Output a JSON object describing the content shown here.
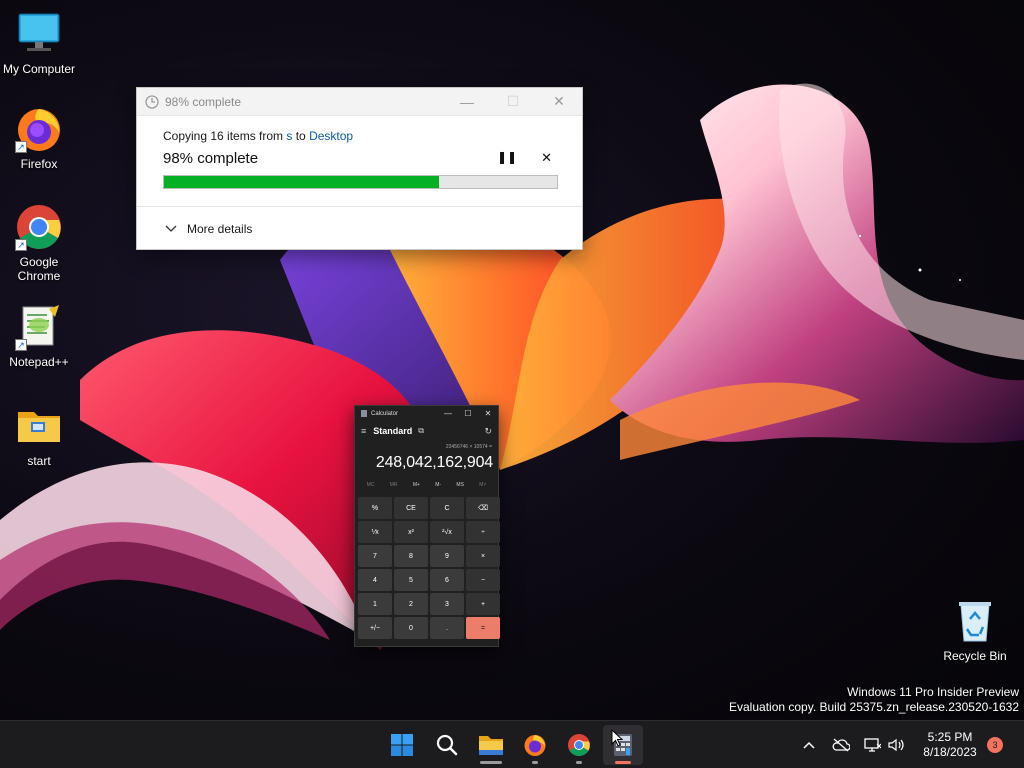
{
  "desktop": {
    "icons": [
      {
        "label": "My Computer",
        "icon": "monitor-icon"
      },
      {
        "label": "Firefox",
        "icon": "firefox-icon"
      },
      {
        "label": "Google Chrome",
        "icon": "chrome-icon"
      },
      {
        "label": "Notepad++",
        "icon": "notepadpp-icon"
      },
      {
        "label": "start",
        "icon": "folder-icon"
      },
      {
        "label": "Recycle Bin",
        "icon": "recycle-bin-icon"
      }
    ]
  },
  "copy_dialog": {
    "title": "98% complete",
    "copy_prefix": "Copying 16 items from ",
    "source": "s",
    "to_word": " to ",
    "destination": "Desktop",
    "status": "98% complete",
    "progress_percent": 70,
    "more_details": "More details",
    "accent_color": "#06b025"
  },
  "calculator": {
    "title": "Calculator",
    "mode": "Standard",
    "expression": "23456746 × 10574 =",
    "display": "248,042,162,904",
    "memory": [
      "MC",
      "MR",
      "M+",
      "M-",
      "MS",
      "M˅"
    ],
    "keys": [
      "%",
      "CE",
      "C",
      "⌫",
      "⅟x",
      "x²",
      "²√x",
      "÷",
      "7",
      "8",
      "9",
      "×",
      "4",
      "5",
      "6",
      "−",
      "1",
      "2",
      "3",
      "+",
      "+/−",
      "0",
      ".",
      "="
    ]
  },
  "watermark": {
    "line1": "Windows 11 Pro Insider Preview",
    "line2": "Evaluation copy. Build 25375.zn_release.230520-1632"
  },
  "taskbar": {
    "apps": [
      "start-icon",
      "search-icon",
      "file-explorer-icon",
      "firefox-icon",
      "chrome-icon",
      "calculator-icon"
    ],
    "time": "5:25 PM",
    "date": "8/18/2023",
    "notification_count": "3"
  }
}
